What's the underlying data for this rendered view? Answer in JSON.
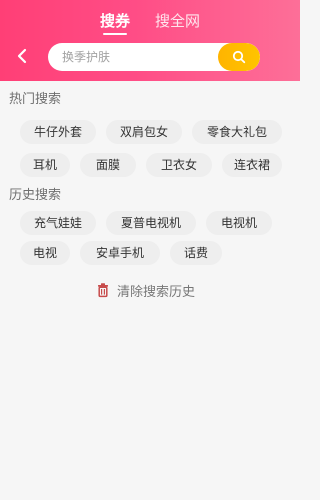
{
  "header": {
    "tabs": [
      {
        "label": "搜券"
      },
      {
        "label": "搜全网"
      }
    ]
  },
  "search": {
    "placeholder": "换季护肤"
  },
  "hot": {
    "title": "热门搜索",
    "items": [
      "牛仔外套",
      "双肩包女",
      "零食大礼包",
      "耳机",
      "面膜",
      "卫衣女",
      "连衣裙"
    ]
  },
  "history": {
    "title": "历史搜索",
    "items": [
      "充气娃娃",
      "夏普电视机",
      "电视机",
      "电视",
      "安卓手机",
      "话费"
    ],
    "clear_label": "清除搜索历史"
  },
  "colors": {
    "header_left": "#ff3f76",
    "header_right": "#fd6f98",
    "search_button": "#ffb800",
    "chip_bg": "#eeeeee",
    "trash_icon": "#c74b4b"
  },
  "icons": {
    "back": "chevron-left-icon",
    "search": "search-icon",
    "clear": "trash-icon"
  }
}
